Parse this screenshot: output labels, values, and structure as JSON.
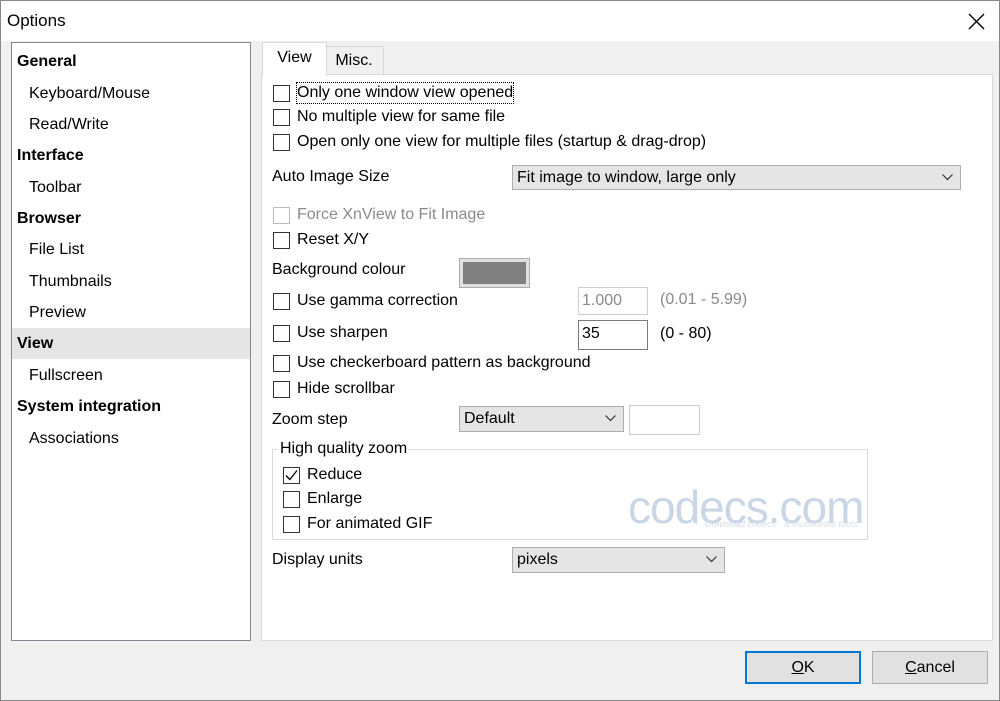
{
  "window": {
    "title": "Options"
  },
  "sidebar": {
    "items": [
      {
        "label": "General",
        "type": "category"
      },
      {
        "label": "Keyboard/Mouse",
        "type": "sub"
      },
      {
        "label": "Read/Write",
        "type": "sub"
      },
      {
        "label": "Interface",
        "type": "category"
      },
      {
        "label": "Toolbar",
        "type": "sub"
      },
      {
        "label": "Browser",
        "type": "category"
      },
      {
        "label": "File List",
        "type": "sub"
      },
      {
        "label": "Thumbnails",
        "type": "sub"
      },
      {
        "label": "Preview",
        "type": "sub"
      },
      {
        "label": "View",
        "type": "category",
        "selected": true
      },
      {
        "label": "Fullscreen",
        "type": "sub"
      },
      {
        "label": "System integration",
        "type": "category"
      },
      {
        "label": "Associations",
        "type": "sub"
      }
    ]
  },
  "tabs": [
    {
      "label": "View",
      "active": true
    },
    {
      "label": "Misc.",
      "active": false
    }
  ],
  "view": {
    "only_one_window": {
      "label": "Only one window view opened",
      "checked": false
    },
    "no_multiple_view": {
      "label": "No multiple view for same file",
      "checked": false
    },
    "open_only_one_view": {
      "label": "Open only one view for multiple files (startup & drag-drop)",
      "checked": false
    },
    "auto_image_size": {
      "label": "Auto Image Size",
      "value": "Fit image to window, large only"
    },
    "force_fit": {
      "label": "Force XnView to Fit Image",
      "checked": false,
      "disabled": true
    },
    "reset_xy": {
      "label": "Reset X/Y",
      "checked": false
    },
    "background_colour": {
      "label": "Background colour",
      "color": "#808080"
    },
    "gamma": {
      "label": "Use gamma correction",
      "checked": false,
      "value": "1.000",
      "range": "(0.01 - 5.99)"
    },
    "sharpen": {
      "label": "Use sharpen",
      "checked": false,
      "value": "35",
      "range": "(0 - 80)"
    },
    "checkerboard": {
      "label": "Use checkerboard pattern as background",
      "checked": false
    },
    "hide_scrollbar": {
      "label": "Hide scrollbar",
      "checked": false
    },
    "zoom_step": {
      "label": "Zoom step",
      "value": "Default",
      "custom_value": ""
    },
    "hq_zoom": {
      "title": "High quality zoom",
      "reduce": {
        "label": "Reduce",
        "checked": true
      },
      "enlarge": {
        "label": "Enlarge",
        "checked": false
      },
      "animated_gif": {
        "label": "For animated GIF",
        "checked": false
      }
    },
    "display_units": {
      "label": "Display units",
      "value": "pixels"
    }
  },
  "watermark": {
    "text": "codecs.com",
    "subtext": "Download codecs · & multimedia tools"
  },
  "buttons": {
    "ok": {
      "accel": "O",
      "rest": "K"
    },
    "cancel": {
      "accel": "C",
      "rest": "ancel"
    }
  },
  "icons": {
    "close": "close-icon",
    "dropdown": "chevron-down-icon",
    "check": "checkmark-icon"
  }
}
